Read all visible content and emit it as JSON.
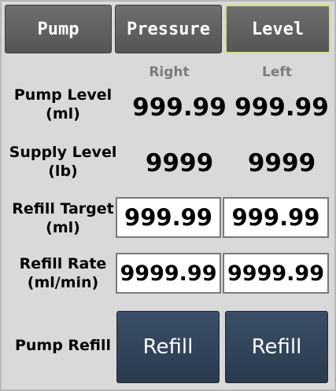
{
  "tabs": [
    {
      "label": "Pump"
    },
    {
      "label": "Pressure"
    },
    {
      "label": "Level"
    }
  ],
  "active_tab": "Level",
  "columns": {
    "right": "Right",
    "left": "Left"
  },
  "rows": {
    "pump_level": {
      "label_line1": "Pump Level",
      "label_line2": "(ml)",
      "right": "999.99",
      "left": "999.99"
    },
    "supply_level": {
      "label_line1": "Supply Level",
      "label_line2": "(lb)",
      "right": "9999",
      "left": "9999"
    },
    "refill_target": {
      "label_line1": "Refill Target",
      "label_line2": "(ml)",
      "right": "999.99",
      "left": "999.99"
    },
    "refill_rate": {
      "label_line1": "Refill Rate",
      "label_line2": "(ml/min)",
      "right": "9999.99",
      "left": "9999.99"
    },
    "pump_refill": {
      "label": "Pump Refill",
      "right_button": "Refill",
      "left_button": "Refill"
    }
  },
  "colors": {
    "panel": "#d9d9d9",
    "tab": "#5f5f5f",
    "active_tab_border": "#c9e27a",
    "refill_button": "#33465c"
  }
}
